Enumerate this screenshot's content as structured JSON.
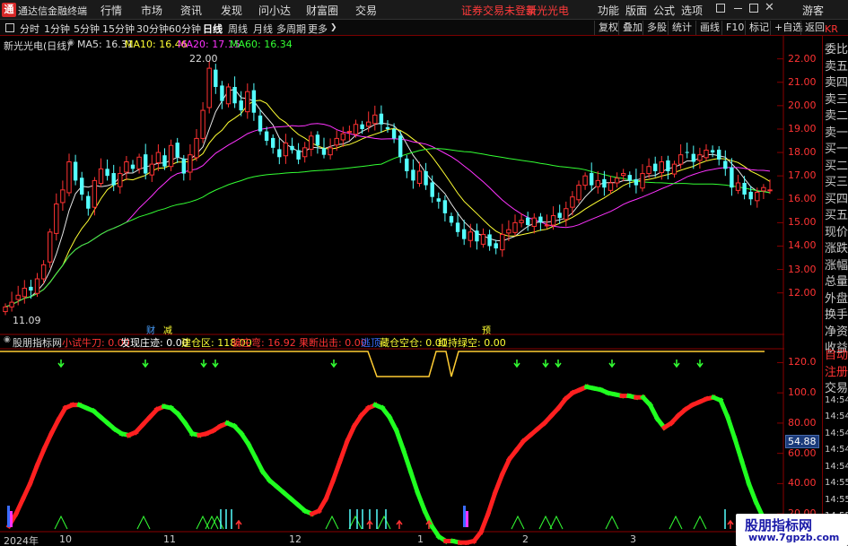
{
  "app_title": "通达信金融终端",
  "menu": [
    "行情",
    "市场",
    "资讯",
    "发现",
    "问小达",
    "财富圈",
    "交易"
  ],
  "menu_notice": "证券交易未登录",
  "menu_stock": "新光光电",
  "menu_right": [
    "功能",
    "版面",
    "公式",
    "选项"
  ],
  "guest": "游客",
  "periods": [
    "分时",
    "1分钟",
    "5分钟",
    "15分钟",
    "30分钟",
    "60分钟",
    "日线",
    "周线",
    "月线",
    "多周期",
    "更多"
  ],
  "active_period": "日线",
  "toolbar_right": [
    "复权",
    "叠加",
    "多股",
    "统计",
    "画线",
    "F10",
    "标记",
    "+自选",
    "返回"
  ],
  "main": {
    "title": "新光光电(日线)",
    "ma5": "MA5: 16.31",
    "ma10": "MA10: 16.46",
    "ma20": "MA20: 17.15",
    "ma60": "MA60: 16.34",
    "high_label": "22.00",
    "low_label": "11.09",
    "price_ticks": [
      "22.00",
      "21.00",
      "20.00",
      "19.00",
      "18.00",
      "17.00",
      "16.00",
      "15.00",
      "14.00",
      "13.00",
      "12.00"
    ],
    "markers": [
      "财",
      "减",
      "预"
    ]
  },
  "sub": {
    "title": "股朋指标网",
    "items": [
      {
        "label": "小试牛刀: 0.00",
        "color": "#ff3333"
      },
      {
        "label": "发现庄迹: 0.00",
        "color": "#ffffff"
      },
      {
        "label": "建仓区: 118.00",
        "color": "#ffff33"
      },
      {
        "label": "骗庄弯: 16.92",
        "color": "#ff3333"
      },
      {
        "label": "果断出击: 0.00",
        "color": "#ff3333"
      },
      {
        "label": "逃顶",
        "color": "#3a6cff"
      },
      {
        "label": "藏仓空仓: 0.00",
        "color": "#ffff33"
      },
      {
        "label": "红持绿空: 0.00",
        "color": "#ffff33"
      }
    ],
    "ticks": [
      "120.0",
      "100.0",
      "80.00",
      "60.00",
      "40.00",
      "20.00"
    ],
    "current_value": "54.88"
  },
  "dates": [
    "2024年",
    "10",
    "11",
    "12",
    "1",
    "2",
    "3"
  ],
  "right_panel": [
    "委比",
    "卖五",
    "卖四",
    "卖三",
    "卖二",
    "卖一",
    "买一",
    "买二",
    "买三",
    "买四",
    "买五",
    "现价",
    "涨跌",
    "涨幅",
    "总量",
    "外盘",
    "换手",
    "净资",
    "收益"
  ],
  "right_panel_top": "KR",
  "right_panel_sub": [
    "自动",
    "注册",
    "交易",
    "14:54",
    "14:54",
    "14:54",
    "14:54",
    "14:54",
    "14:55",
    "14:55",
    "14:55",
    "14:55"
  ],
  "watermark": {
    "title": "股朋指标网",
    "url": "www.7gpzb.com"
  },
  "chart_data": {
    "type": "candlestick",
    "ylim": [
      10.8,
      22.6
    ],
    "closes": [
      11.4,
      11.6,
      11.9,
      12.2,
      12.1,
      12.6,
      13.2,
      14.6,
      15.8,
      16.4,
      17.6,
      16.8,
      16.2,
      15.6,
      16.8,
      17.3,
      17.0,
      16.6,
      17.1,
      17.6,
      17.3,
      17.8,
      17.1,
      17.5,
      18.0,
      17.4,
      18.3,
      17.8,
      17.1,
      17.9,
      18.6,
      19.8,
      21.6,
      20.8,
      20.2,
      20.8,
      20.1,
      19.8,
      20.6,
      19.7,
      18.9,
      18.5,
      18.2,
      17.8,
      18.4,
      18.1,
      17.7,
      18.2,
      18.7,
      18.3,
      17.9,
      18.2,
      18.6,
      18.8,
      18.9,
      19.2,
      19.0,
      19.3,
      19.6,
      19.2,
      19.0,
      18.6,
      17.8,
      17.2,
      16.8,
      17.2,
      16.6,
      16.1,
      15.9,
      15.4,
      15.0,
      14.6,
      14.3,
      14.6,
      14.2,
      14.5,
      14.0,
      13.9,
      14.5,
      14.7,
      15.0,
      15.1,
      14.9,
      15.2,
      15.0,
      14.9,
      15.3,
      15.2,
      15.6,
      16.1,
      16.6,
      17.0,
      16.6,
      16.8,
      16.5,
      16.7,
      16.9,
      17.1,
      16.8,
      16.6,
      17.1,
      17.4,
      17.2,
      17.6,
      17.2,
      17.5,
      17.9,
      18.0,
      17.6,
      17.9,
      18.1,
      18.0,
      17.7,
      17.3,
      16.5,
      16.7,
      16.2,
      16.0,
      16.3,
      16.5,
      16.4
    ],
    "series": [
      {
        "name": "MA5",
        "values": []
      },
      {
        "name": "MA10",
        "values": []
      },
      {
        "name": "MA20",
        "values": []
      },
      {
        "name": "MA60",
        "values": []
      }
    ],
    "indicator": {
      "ylim": [
        10,
        125
      ],
      "values": [
        12,
        20,
        30,
        40,
        52,
        63,
        73,
        82,
        90,
        92,
        92,
        90,
        88,
        84,
        80,
        76,
        73,
        72,
        74,
        79,
        84,
        89,
        91,
        90,
        86,
        80,
        73,
        72,
        73,
        75,
        78,
        80,
        78,
        73,
        66,
        57,
        48,
        42,
        38,
        34,
        30,
        26,
        22,
        20,
        22,
        30,
        42,
        55,
        68,
        78,
        85,
        90,
        92,
        90,
        84,
        75,
        62,
        48,
        34,
        22,
        12,
        5,
        2,
        2,
        1,
        1,
        2,
        8,
        20,
        34,
        46,
        56,
        62,
        68,
        72,
        76,
        80,
        85,
        90,
        96,
        100,
        102,
        104,
        103,
        102,
        100,
        99,
        98,
        98,
        97,
        97,
        92,
        83,
        77,
        80,
        85,
        89,
        92,
        94,
        96,
        97,
        95,
        84,
        70,
        55,
        40,
        28,
        18,
        12
      ]
    }
  }
}
